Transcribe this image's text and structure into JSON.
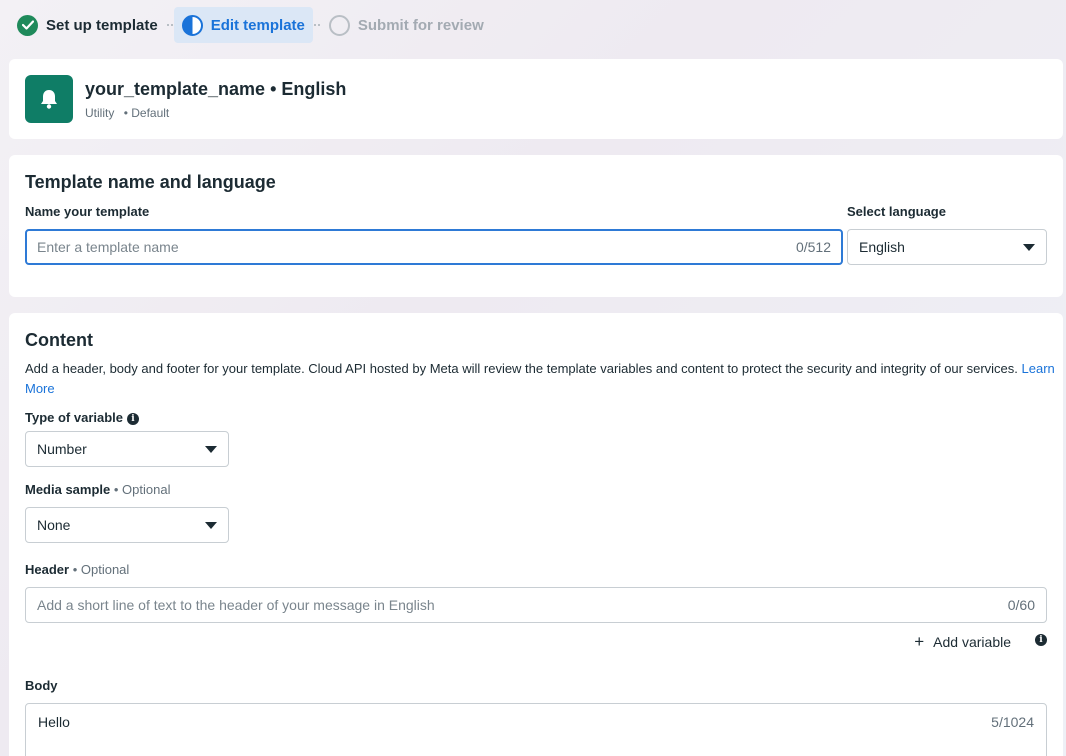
{
  "stepper": {
    "steps": [
      {
        "label": "Set up template",
        "state": "done"
      },
      {
        "label": "Edit template",
        "state": "active"
      },
      {
        "label": "Submit for review",
        "state": "todo"
      }
    ]
  },
  "template": {
    "title": "your_template_name • English",
    "category": "Utility",
    "type": "• Default",
    "logo_icon": "bell-icon",
    "logo_color": "#0f7d66"
  },
  "name_section": {
    "heading": "Template name and language",
    "name_label": "Name your template",
    "name_placeholder": "Enter a template name",
    "name_value": "",
    "name_counter": "0/512",
    "language_label": "Select language",
    "language_value": "English"
  },
  "content": {
    "heading": "Content",
    "description": "Add a header, body and footer for your template. Cloud API hosted by Meta will review the template variables and content to protect the security and integrity of our services.",
    "learn_more": "Learn More",
    "variable_type_label": "Type of variable",
    "variable_type_value": "Number",
    "media_label": "Media sample",
    "media_optional": "• Optional",
    "media_value": "None",
    "header_label": "Header",
    "header_optional": "• Optional",
    "header_placeholder": "Add a short line of text to the header of your message in English",
    "header_counter": "0/60",
    "add_variable": "Add variable",
    "body_label": "Body",
    "body_value": "Hello",
    "body_counter": "5/1024"
  }
}
